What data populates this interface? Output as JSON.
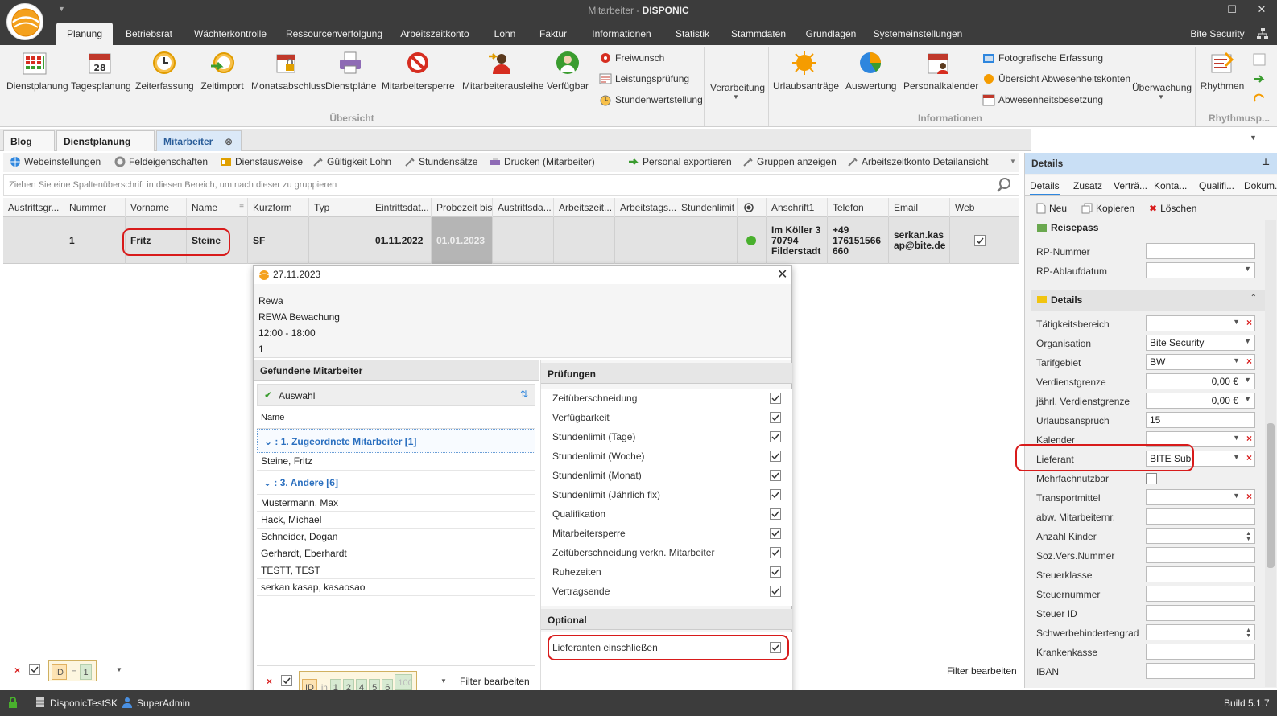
{
  "window": {
    "title_prefix": "Mitarbeiter - ",
    "title_app": "DISPONIC",
    "minimize": "—",
    "maximize": "☐",
    "close": "✕"
  },
  "menu": {
    "tabs": [
      "Planung",
      "Betriebsrat",
      "Wächterkontrolle",
      "Ressourcenverfolgung",
      "Arbeitszeitkonto",
      "Lohn",
      "Faktur",
      "Informationen",
      "Statistik",
      "Stammdaten",
      "Grundlagen",
      "Systemeinstellungen"
    ],
    "user_org": "Bite Security"
  },
  "ribbon": {
    "buttons": [
      "Dienstplanung",
      "Tagesplanung",
      "Zeiterfassung",
      "Zeitimport",
      "Monatsabschluss",
      "Dienstpläne",
      "Mitarbeitersperre",
      "Mitarbeiterausleihe",
      "Verfügbar"
    ],
    "small1": [
      "Freiwunsch",
      "Leistungsprüfung",
      "Stundenwertstellung"
    ],
    "verarbeitung": "Verarbeitung",
    "info_buttons": [
      "Urlaubsanträge",
      "Auswertung",
      "Personalkalender"
    ],
    "small2": [
      "Fotografische Erfassung",
      "Übersicht Abwesenheitskonten",
      "Abwesenheitsbesetzung"
    ],
    "ueberwachung": "Überwachung",
    "rhythmen": "Rhythmen",
    "group_uebersicht": "Übersicht",
    "group_informationen": "Informationen",
    "group_rhythmus": "Rhythmusp..."
  },
  "doctabs": [
    "Blog",
    "Dienstplanung",
    "Mitarbeiter"
  ],
  "toolbar": [
    "Webeinstellungen",
    "Feldeigenschaften",
    "Dienstausweise",
    "Gültigkeit Lohn",
    "Stundensätze",
    "Drucken (Mitarbeiter)",
    "Personal exportieren",
    "Gruppen anzeigen",
    "Arbeitszeitkonto Detailansicht"
  ],
  "group_hint": "Ziehen Sie eine Spaltenüberschrift in diesen Bereich, um nach dieser zu gruppieren",
  "grid": {
    "headers": [
      "Austrittsgr...",
      "Nummer",
      "Vorname",
      "Name",
      "Kurzform",
      "Typ",
      "Eintrittsdat...",
      "Probezeit bis",
      "Austrittsda...",
      "Arbeitszeit...",
      "Arbeitstags...",
      "Stundenlimit",
      "",
      "Anschrift1",
      "Telefon",
      "Email",
      "Web"
    ],
    "row": {
      "nummer": "1",
      "vorname": "Fritz",
      "name": "Steine",
      "kurzform": "SF",
      "eintritt": "01.11.2022",
      "probezeit": "01.01.2023",
      "anschrift_l1": "Im Köller 3",
      "anschrift_l2": "70794",
      "anschrift_l3": "Filderstadt",
      "telefon_l1": "+49",
      "telefon_l2": "176151566",
      "telefon_l3": "660",
      "email_l1": "serkan.kas",
      "email_l2": "ap@bite.de"
    }
  },
  "left_filter": {
    "field": "ID",
    "op": "=",
    "value": "1",
    "edit": "Filter bearbeiten"
  },
  "popup": {
    "date": "27.11.2023",
    "info": [
      "Rewa",
      "REWA Bewachung",
      "12:00 - 18:00",
      "1"
    ],
    "found_header": "Gefundene Mitarbeiter",
    "auswahl": "Auswahl",
    "name_col": "Name",
    "group1": ": 1. Zugeordnete Mitarbeiter [1]",
    "group1_items": [
      "Steine, Fritz"
    ],
    "group2": ": 3. Andere [6]",
    "group2_items": [
      "Mustermann, Max",
      "Hack, Michael",
      "Schneider, Dogan",
      "Gerhardt, Eberhardt",
      "TESTT, TEST",
      "serkan kasap, kasaosao"
    ],
    "checks_header": "Prüfungen",
    "checks": [
      "Zeitüberschneidung",
      "Verfügbarkeit",
      "Stundenlimit (Tage)",
      "Stundenlimit (Woche)",
      "Stundenlimit (Monat)",
      "Stundenlimit (Jährlich fix)",
      "Qualifikation",
      "Mitarbeitersperre",
      "Zeitüberschneidung verkn. Mitarbeiter",
      "Ruhezeiten",
      "Vertragsende"
    ],
    "optional_header": "Optional",
    "optional": "Lieferanten einschließen",
    "filter": {
      "field": "ID",
      "op": "in",
      "values": [
        "1",
        "2",
        "4",
        "5",
        "6",
        "100"
      ],
      "edit": "Filter bearbeiten"
    }
  },
  "details": {
    "title": "Details",
    "tabs": [
      "Details",
      "Zusatz",
      "Verträ...",
      "Konta...",
      "Qualifi...",
      "Dokum..."
    ],
    "actions": [
      "Neu",
      "Kopieren",
      "Löschen"
    ],
    "section1": "Reisepass",
    "section2": "Details",
    "fields1": [
      {
        "label": "RP-Nummer",
        "value": ""
      },
      {
        "label": "RP-Ablaufdatum",
        "value": ""
      }
    ],
    "fields": [
      {
        "label": "Tätigkeitsbereich",
        "value": ""
      },
      {
        "label": "Organisation",
        "value": "Bite Security"
      },
      {
        "label": "Tarifgebiet",
        "value": "BW"
      },
      {
        "label": "Verdienstgrenze",
        "value": "0,00 €"
      },
      {
        "label": "jährl. Verdienstgrenze",
        "value": "0,00 €"
      },
      {
        "label": "Urlaubsanspruch",
        "value": "15"
      },
      {
        "label": "Kalender",
        "value": ""
      },
      {
        "label": "Lieferant",
        "value": "BITE Sub"
      },
      {
        "label": "Mehrfachnutzbar",
        "value": ""
      },
      {
        "label": "Transportmittel",
        "value": ""
      },
      {
        "label": "abw. Mitarbeiternr.",
        "value": ""
      },
      {
        "label": "Anzahl Kinder",
        "value": ""
      },
      {
        "label": "Soz.Vers.Nummer",
        "value": ""
      },
      {
        "label": "Steuerklasse",
        "value": ""
      },
      {
        "label": "Steuernummer",
        "value": ""
      },
      {
        "label": "Steuer ID",
        "value": ""
      },
      {
        "label": "Schwerbehindertengrad",
        "value": ""
      },
      {
        "label": "Krankenkasse",
        "value": ""
      },
      {
        "label": "IBAN",
        "value": ""
      }
    ]
  },
  "status": {
    "db": "DisponicTestSK",
    "user": "SuperAdmin",
    "build": "Build 5.1.7"
  }
}
